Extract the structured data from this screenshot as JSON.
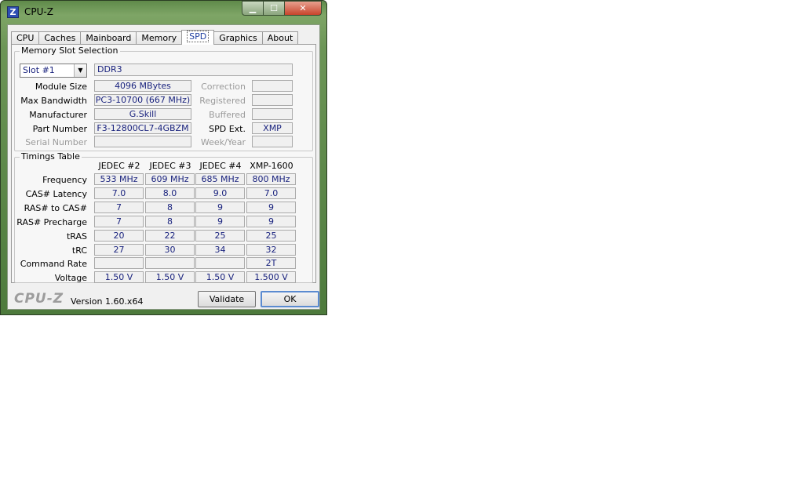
{
  "window": {
    "title": "CPU-Z",
    "icon_letter": "Z",
    "controls": {
      "minimize": "minimize-icon",
      "maximize": "maximize-icon",
      "close": "close-icon"
    }
  },
  "tabs": [
    {
      "label": "CPU",
      "active": false
    },
    {
      "label": "Caches",
      "active": false
    },
    {
      "label": "Mainboard",
      "active": false
    },
    {
      "label": "Memory",
      "active": false
    },
    {
      "label": "SPD",
      "active": true
    },
    {
      "label": "Graphics",
      "active": false
    },
    {
      "label": "About",
      "active": false
    }
  ],
  "slot": {
    "group_title": "Memory Slot Selection",
    "selected": "Slot #1",
    "type": "DDR3",
    "left_fields": [
      {
        "label": "Module Size",
        "value": "4096 MBytes"
      },
      {
        "label": "Max Bandwidth",
        "value": "PC3-10700 (667 MHz)"
      },
      {
        "label": "Manufacturer",
        "value": "G.Skill"
      },
      {
        "label": "Part Number",
        "value": "F3-12800CL7-4GBZM"
      },
      {
        "label": "Serial Number",
        "value": ""
      }
    ],
    "right_fields": [
      {
        "label": "Correction",
        "value": ""
      },
      {
        "label": "Registered",
        "value": ""
      },
      {
        "label": "Buffered",
        "value": ""
      },
      {
        "label": "SPD Ext.",
        "value": "XMP"
      },
      {
        "label": "Week/Year",
        "value": ""
      }
    ]
  },
  "timings": {
    "group_title": "Timings Table",
    "columns": [
      "JEDEC #2",
      "JEDEC #3",
      "JEDEC #4",
      "XMP-1600"
    ],
    "rows": [
      {
        "label": "Frequency",
        "values": [
          "533 MHz",
          "609 MHz",
          "685 MHz",
          "800 MHz"
        ]
      },
      {
        "label": "CAS# Latency",
        "values": [
          "7.0",
          "8.0",
          "9.0",
          "7.0"
        ]
      },
      {
        "label": "RAS# to CAS#",
        "values": [
          "7",
          "8",
          "9",
          "9"
        ]
      },
      {
        "label": "RAS# Precharge",
        "values": [
          "7",
          "8",
          "9",
          "9"
        ]
      },
      {
        "label": "tRAS",
        "values": [
          "20",
          "22",
          "25",
          "25"
        ]
      },
      {
        "label": "tRC",
        "values": [
          "27",
          "30",
          "34",
          "32"
        ]
      },
      {
        "label": "Command Rate",
        "values": [
          "",
          "",
          "",
          "2T"
        ]
      },
      {
        "label": "Voltage",
        "values": [
          "1.50 V",
          "1.50 V",
          "1.50 V",
          "1.500 V"
        ]
      }
    ]
  },
  "footer": {
    "brand": "CPU-Z",
    "version": "Version 1.60.x64",
    "validate_label": "Validate",
    "ok_label": "OK"
  }
}
